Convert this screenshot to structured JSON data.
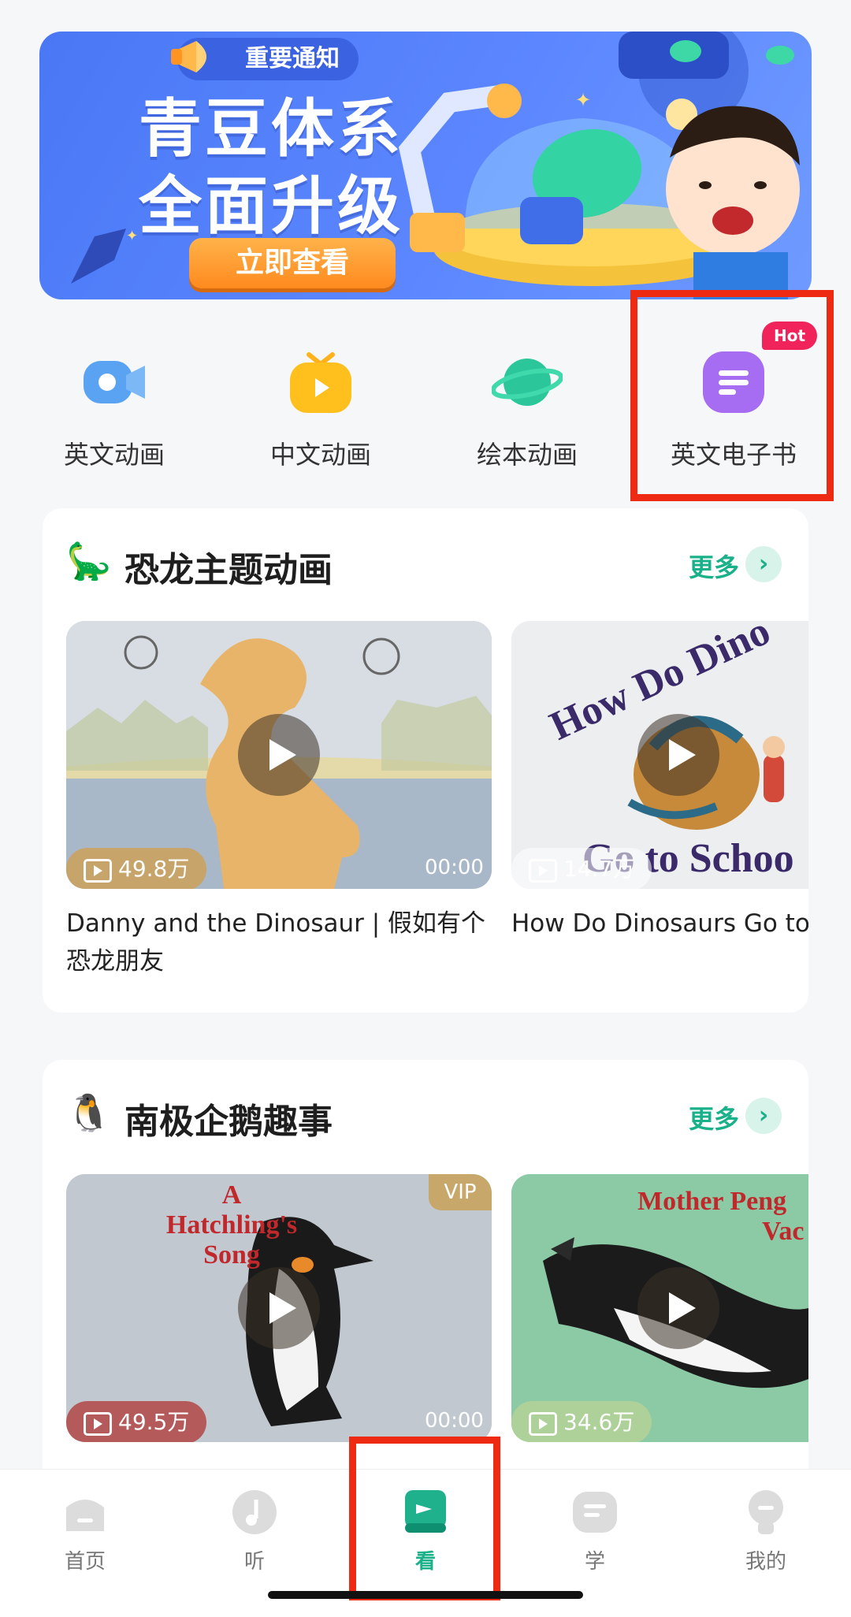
{
  "banner": {
    "notice_label": "重要通知",
    "title_line1": "青豆体系",
    "title_line2": "全面升级",
    "cta_label": "立即查看"
  },
  "categories": [
    {
      "label": "英文动画",
      "icon": "video-camera-icon",
      "color": "#5aa2f2"
    },
    {
      "label": "中文动画",
      "icon": "tv-play-icon",
      "color": "#ffb21c"
    },
    {
      "label": "绘本动画",
      "icon": "planet-icon",
      "color": "#2bc79a"
    },
    {
      "label": "英文电子书",
      "icon": "ebook-icon",
      "color": "#a66cf2",
      "badge": "Hot"
    }
  ],
  "sections": [
    {
      "emoji": "🦕",
      "title": "恐龙主题动画",
      "more_label": "更多",
      "items": [
        {
          "views": "49.8万",
          "duration": "00:00",
          "title": "Danny and the Dinosaur | 假如有个恐龙朋友"
        },
        {
          "views": "14.7万",
          "duration": "",
          "title": "How Do Dinosaurs Go to",
          "thumb_text_top": "How Do Dino",
          "thumb_text_bottom": "Go to Schoo"
        }
      ]
    },
    {
      "emoji": "🐧",
      "title": "南极企鹅趣事",
      "more_label": "更多",
      "items": [
        {
          "views": "49.5万",
          "duration": "00:00",
          "badge": "VIP",
          "thumb_text_1": "A",
          "thumb_text_2": "Hatchling's",
          "thumb_text_3": "Song"
        },
        {
          "views": "34.6万",
          "duration": "",
          "thumb_text_1": "Mother Peng",
          "thumb_text_2": "Vac"
        }
      ]
    }
  ],
  "nav": {
    "items": [
      {
        "label": "首页",
        "icon": "home-icon",
        "active": false
      },
      {
        "label": "听",
        "icon": "music-note-icon",
        "active": false
      },
      {
        "label": "看",
        "icon": "watch-book-icon",
        "active": true
      },
      {
        "label": "学",
        "icon": "learn-icon",
        "active": false
      },
      {
        "label": "我的",
        "icon": "profile-icon",
        "active": false
      }
    ]
  },
  "colors": {
    "accent": "#19b08a",
    "highlight_box": "#ef2a12",
    "hot_badge": "#f0245a"
  }
}
